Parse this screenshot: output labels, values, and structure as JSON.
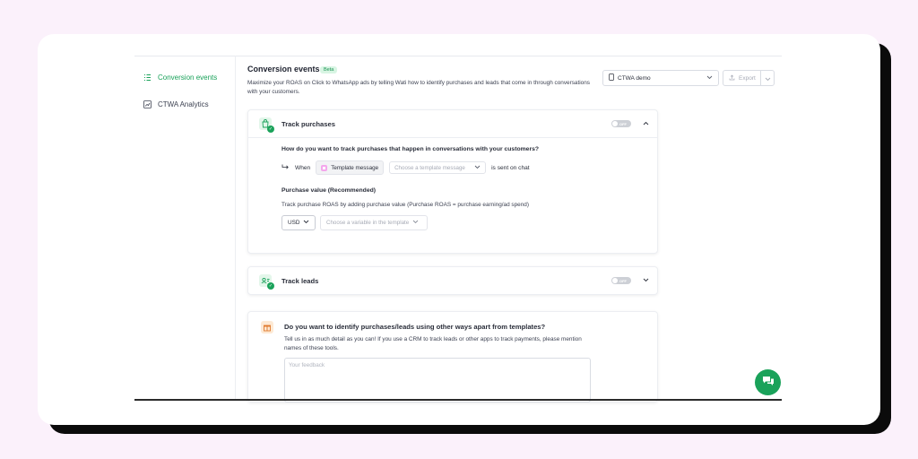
{
  "sidebar": {
    "items": [
      {
        "label": "Conversion events",
        "icon": "list-check-icon",
        "active": true
      },
      {
        "label": "CTWA Analytics",
        "icon": "chart-icon",
        "active": false
      }
    ]
  },
  "header": {
    "title": "Conversion events",
    "badge": "Beta",
    "subtitle": "Maximize your ROAS on Click to WhatsApp ads by telling Wati how to identify purchases and leads that come in through conversations with your customers.",
    "account_select": "CTWA demo",
    "export_label": "Export"
  },
  "purchases": {
    "title": "Track purchases",
    "toggle_label": "OFF",
    "question": "How do you want to track purchases that happen in conversations with your customers?",
    "when_label": "When",
    "template_tag": "Template message",
    "template_placeholder": "Choose a template message",
    "sent_label": "is sent on chat",
    "value_title": "Purchase value (Recommended)",
    "value_desc": "Track purchase ROAS by adding purchase value (Purchase ROAS = purchase earning/ad spend)",
    "currency": "USD",
    "variable_placeholder": "Choose a variable in the template"
  },
  "leads": {
    "title": "Track leads",
    "toggle_label": "OFF"
  },
  "feedback": {
    "question": "Do you want to identify purchases/leads using other ways apart from templates?",
    "desc": "Tell us in as much detail as you can! If you use a CRM to track leads or other apps to track payments, please mention names of these tools.",
    "placeholder": "Your feedback"
  },
  "colors": {
    "accent": "#1aa25a",
    "background": "#fbf1fb"
  }
}
